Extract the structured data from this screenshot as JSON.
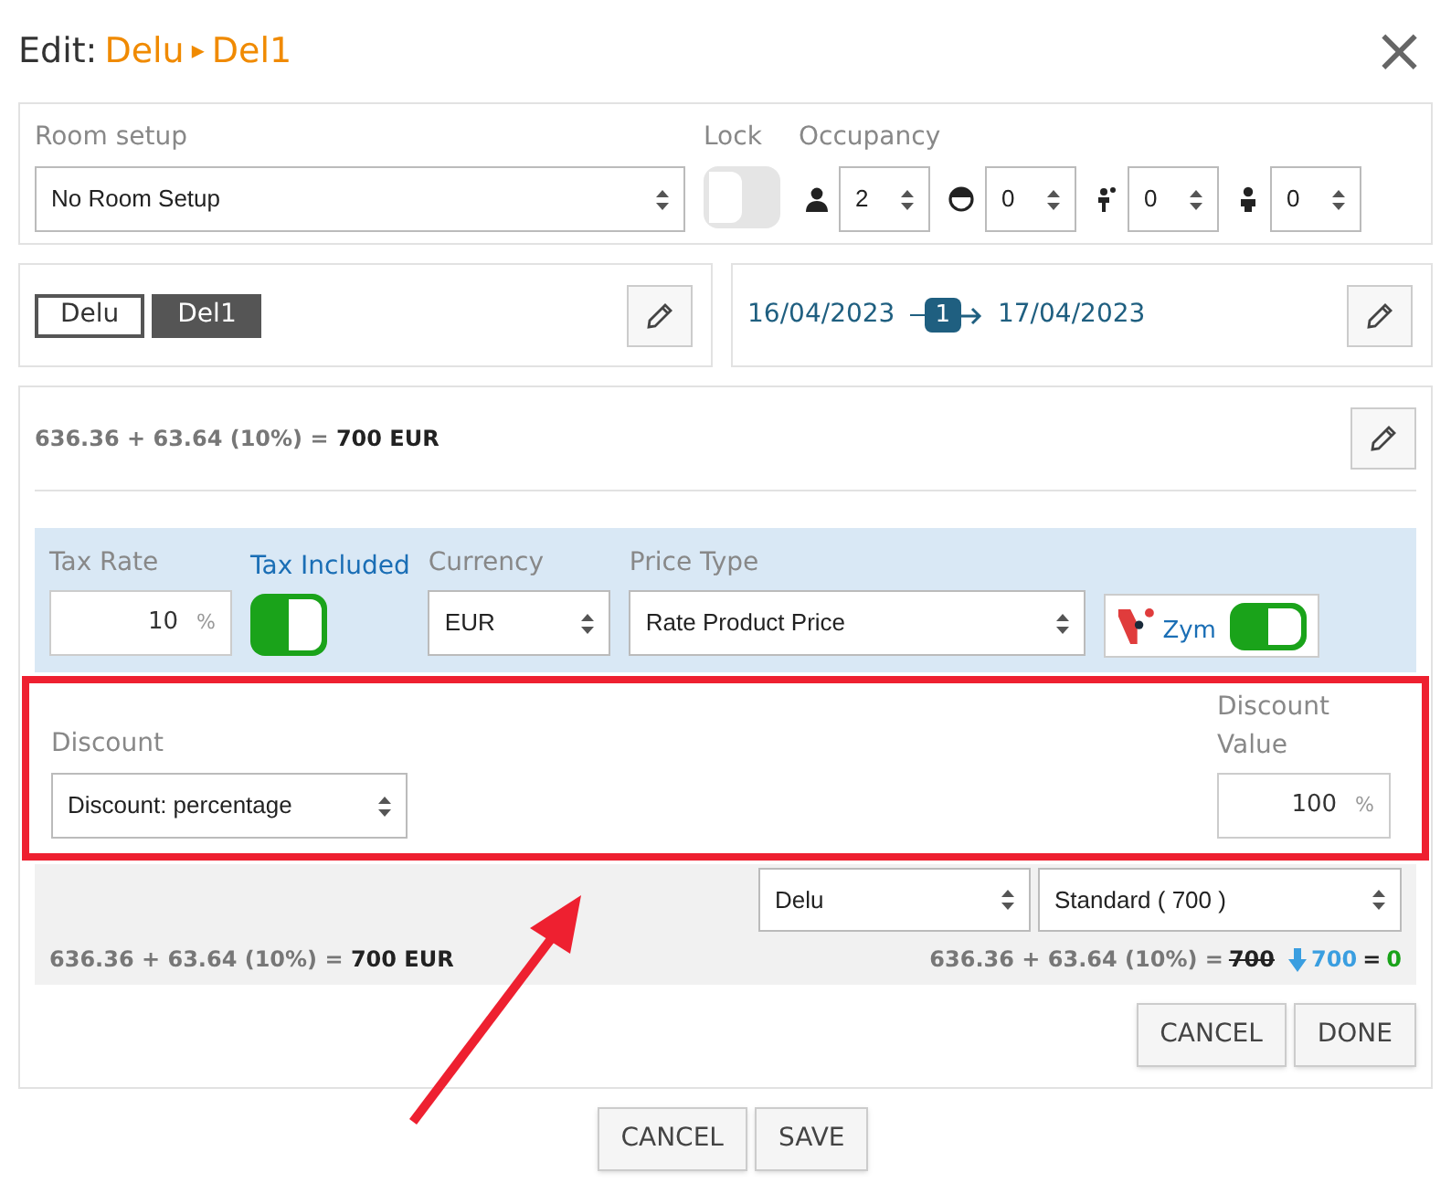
{
  "dialog": {
    "title_prefix": "Edit:",
    "path": [
      "Delu",
      "Del1"
    ],
    "separator": "▸",
    "close": "×"
  },
  "room": {
    "label": "Room setup",
    "value": "No Room Setup",
    "lock_label": "Lock",
    "lock_on": false,
    "occupancy_label": "Occupancy",
    "occupancy": [
      {
        "kind": "adult",
        "value": "2"
      },
      {
        "kind": "child",
        "value": "0"
      },
      {
        "kind": "kid",
        "value": "0"
      },
      {
        "kind": "infant",
        "value": "0"
      }
    ]
  },
  "tags": [
    {
      "label": "Delu",
      "selected": false
    },
    {
      "label": "Del1",
      "selected": true
    }
  ],
  "dates": {
    "from": "16/04/2023",
    "nights": "1",
    "to": "17/04/2023"
  },
  "price": {
    "summary": "636.36 + 63.64 (10%) = **700 EUR**",
    "tax_rate_label": "Tax Rate",
    "tax_rate": "10",
    "percent": "%",
    "tax_included_label": "Tax Included",
    "tax_included": true,
    "currency_label": "Currency",
    "currency": "EUR",
    "price_type_label": "Price Type",
    "price_type": "Rate Product Price",
    "zym_label": "Zym",
    "zym_on": true,
    "discount_label": "Discount",
    "discount": "Discount: percentage",
    "discount_value_label": "Discount Value",
    "discount_value": "100",
    "discount_unit": "%",
    "room_select": "Delu",
    "rate_select": "Standard ( 700 )",
    "footer_left": "636.36 + 63.64 (10%) = **700 EUR**",
    "footer_right_base": "636.36 + 63.64 (10%) =",
    "footer_right_old": "700",
    "footer_right_new": "700",
    "footer_right_eq": "=",
    "footer_right_diff": "0",
    "buttons": [
      "CANCEL",
      "DONE"
    ]
  },
  "buttons": [
    "CANCEL",
    "SAVE"
  ]
}
